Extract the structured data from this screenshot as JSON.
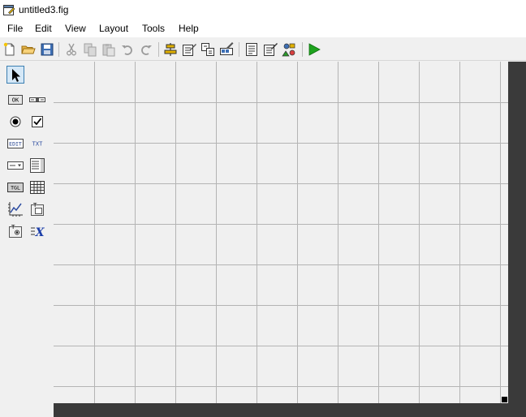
{
  "window": {
    "title": "untitled3.fig"
  },
  "menubar": {
    "items": [
      "File",
      "Edit",
      "View",
      "Layout",
      "Tools",
      "Help"
    ]
  },
  "toolbar": {
    "buttons": [
      "new-figure-icon",
      "open-folder-icon",
      "save-icon",
      "cut-icon",
      "copy-icon",
      "paste-icon",
      "undo-icon",
      "redo-icon",
      "align-objects-icon",
      "menu-editor-icon",
      "tab-order-editor-icon",
      "toolbar-editor-icon",
      "editor-icon",
      "property-inspector-icon",
      "object-browser-icon",
      "run-figure-icon"
    ]
  },
  "palette": {
    "tools": [
      {
        "name": "select",
        "label": ""
      },
      {
        "name": "push-button",
        "label": "OK"
      },
      {
        "name": "slider",
        "label": ""
      },
      {
        "name": "radio-button",
        "label": ""
      },
      {
        "name": "check-box",
        "label": ""
      },
      {
        "name": "edit-text",
        "label": "EDIT"
      },
      {
        "name": "static-text",
        "label": "TXT"
      },
      {
        "name": "pop-up-menu",
        "label": ""
      },
      {
        "name": "list-box",
        "label": ""
      },
      {
        "name": "toggle-button",
        "label": "TGL"
      },
      {
        "name": "table",
        "label": ""
      },
      {
        "name": "axes",
        "label": ""
      },
      {
        "name": "panel",
        "label": "T"
      },
      {
        "name": "button-group",
        "label": "T"
      },
      {
        "name": "activex-control",
        "label": "X"
      }
    ]
  },
  "colors": {
    "chrome": "#f0f0f0",
    "canvas_bg": "#f0f0f0",
    "grid_line": "#b4b4b4",
    "canvas_border": "#3a3a3a",
    "selection": "#3c7fb1",
    "run_green": "#1ea31e"
  }
}
